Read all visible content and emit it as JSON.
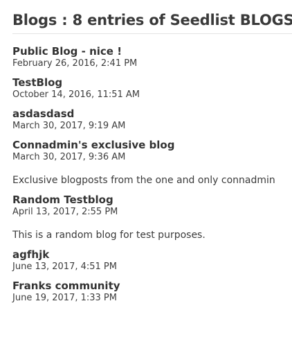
{
  "page": {
    "title": "Blogs : 8 entries of Seedlist BLOGS"
  },
  "entries": [
    {
      "title": "Public Blog - nice !",
      "date": "February 26, 2016, 2:41 PM",
      "description": ""
    },
    {
      "title": "TestBlog",
      "date": "October 14, 2016, 11:51 AM",
      "description": ""
    },
    {
      "title": "asdasdasd",
      "date": "March 30, 2017, 9:19 AM",
      "description": ""
    },
    {
      "title": "Connadmin's exclusive blog",
      "date": "March 30, 2017, 9:36 AM",
      "description": "Exclusive blogposts from the one and only connadmin"
    },
    {
      "title": "Random Testblog",
      "date": "April 13, 2017, 2:55 PM",
      "description": "This is a random blog for test purposes."
    },
    {
      "title": "agfhjk",
      "date": "June 13, 2017, 4:51 PM",
      "description": ""
    },
    {
      "title": "Franks community",
      "date": "June 19, 2017, 1:33 PM",
      "description": ""
    }
  ]
}
